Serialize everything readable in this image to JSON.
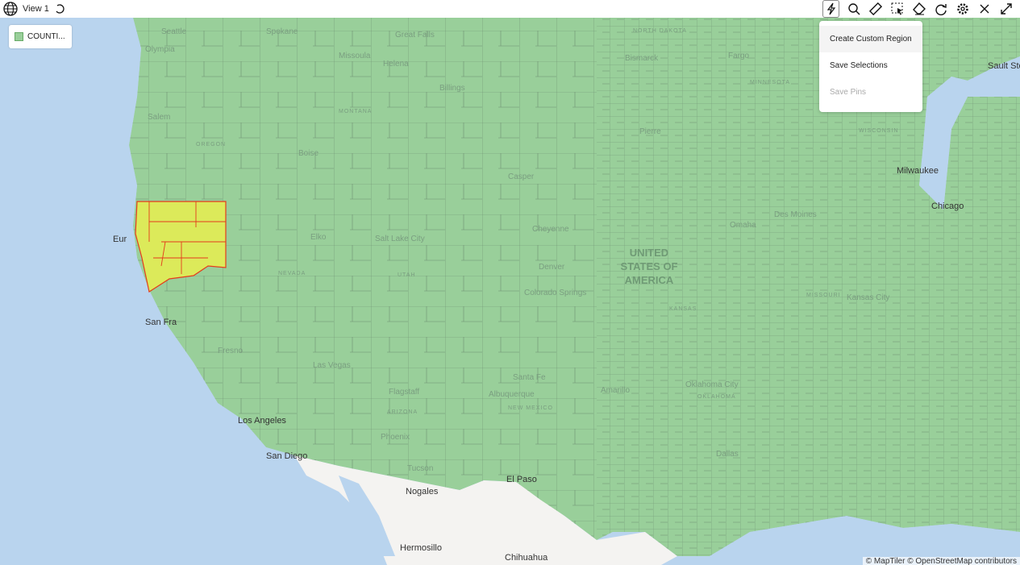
{
  "header": {
    "title": "View 1",
    "icons": [
      "globe-icon",
      "refresh-icon"
    ]
  },
  "toolbar": {
    "tools": [
      "lightning-icon",
      "search-icon",
      "ruler-icon",
      "box-select-icon",
      "eraser-icon",
      "redo-icon",
      "gear-icon",
      "close-icon",
      "expand-icon"
    ]
  },
  "legend": {
    "label": "COUNTI...",
    "color": "#99cf9a"
  },
  "menu": {
    "items": [
      {
        "label": "Create Custom Region",
        "state": "hover"
      },
      {
        "label": "Save Selections",
        "state": "enabled"
      },
      {
        "label": "Save Pins",
        "state": "disabled"
      }
    ]
  },
  "colors": {
    "land": "#99cf9a",
    "selected": "#dcea5a",
    "selected_border": "#e53b1c",
    "ocean": "#b9d4ee",
    "mexico": "#f4f3f1"
  },
  "map": {
    "country_label": [
      "UNITED",
      "STATES OF",
      "AMERICA"
    ],
    "cities": [
      "Seattle",
      "Spokane",
      "Great Falls",
      "Olympia",
      "Missoula",
      "Helena",
      "Billings",
      "Bismarck",
      "Fargo",
      "Salem",
      "Boise",
      "Casper",
      "Eur",
      "Elko",
      "Salt Lake City",
      "Cheyenne",
      "Denver",
      "Colorado Springs",
      "San Fra",
      "Fresno",
      "Las Vegas",
      "Los Angeles",
      "San Diego",
      "Flagstaff",
      "Phoenix",
      "Albuquerque",
      "Santa Fe",
      "Tucson",
      "Nogales",
      "El Paso",
      "Hermosillo",
      "Chihuahua",
      "Amarillo",
      "Oklahoma City",
      "Dallas",
      "Omaha",
      "Des Moines",
      "Chicago",
      "Milwaukee",
      "Sault Ste. Ma",
      "Pierre",
      "Kansas City"
    ],
    "states": [
      "OREGON",
      "NEVADA",
      "UTAH",
      "ARIZONA",
      "NEW MEXICO",
      "MONTANA",
      "NORTH DAKOTA",
      "MINNESOTA",
      "WISCONSIN",
      "KANSAS",
      "OKLAHOMA",
      "MISSOURI"
    ]
  },
  "attribution": "© MapTiler  © OpenStreetMap contributors"
}
